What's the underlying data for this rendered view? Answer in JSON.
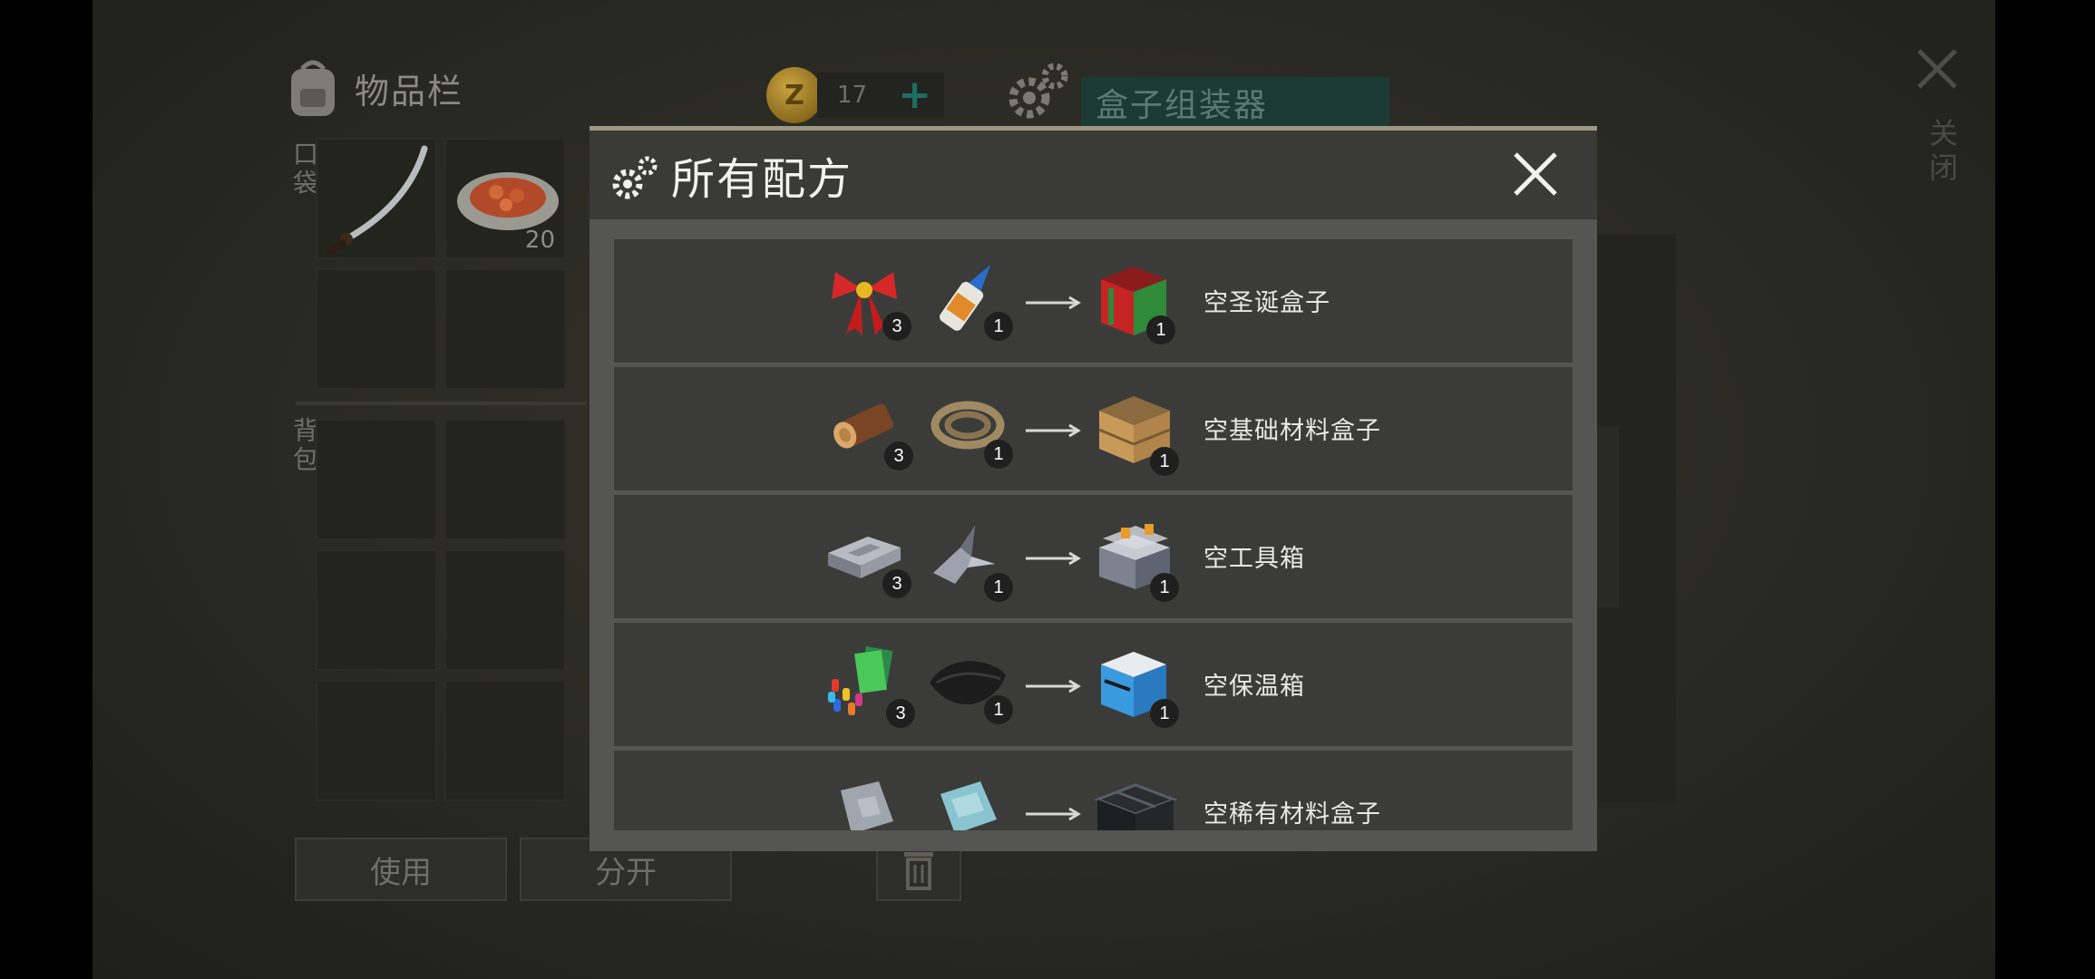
{
  "inventory": {
    "title": "物品栏",
    "pocket_label": "口袋",
    "backpack_label": "背包",
    "slot_count": "20",
    "use_button": "使用",
    "split_button": "分开"
  },
  "currency": {
    "amount": "17",
    "coin_letter": "Z",
    "plus": "+"
  },
  "crafter": {
    "title": "盒子组装器"
  },
  "close_label": "关闭",
  "modal": {
    "title": "所有配方",
    "recipes": [
      {
        "input1_count": "3",
        "input2_count": "1",
        "output_count": "1",
        "name": "空圣诞盒子"
      },
      {
        "input1_count": "3",
        "input2_count": "1",
        "output_count": "1",
        "name": "空基础材料盒子"
      },
      {
        "input1_count": "3",
        "input2_count": "1",
        "output_count": "1",
        "name": "空工具箱"
      },
      {
        "input1_count": "3",
        "input2_count": "1",
        "output_count": "1",
        "name": "空保温箱"
      },
      {
        "input1_count": "",
        "input2_count": "",
        "output_count": "",
        "name": "空稀有材料盒子"
      }
    ]
  },
  "colors": {
    "accent_teal": "#1c6e62",
    "modal_border": "#9a9782"
  }
}
